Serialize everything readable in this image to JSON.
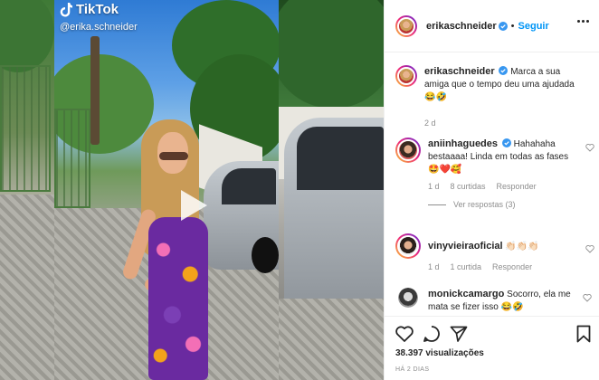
{
  "media": {
    "watermark_brand": "TikTok",
    "watermark_handle": "@erika.schneider"
  },
  "post": {
    "author": "erikaschneider",
    "follow_label": "Seguir",
    "dot": "•",
    "caption": "Marca a sua amiga que o tempo deu uma ajudada 😂🤣",
    "caption_continued": "😂🤣",
    "caption_time": "2 d"
  },
  "comments": [
    {
      "user": "aniinhaguedes",
      "text": "Hahahaha bestaaaa! Linda em todas as fases",
      "emojis": "🤩❤️🥰",
      "time": "1 d",
      "likes": "8 curtidas",
      "reply": "Responder",
      "view_replies": "Ver respostas (3)"
    },
    {
      "user": "vinyvieiraoficial",
      "text": "👏🏻👏🏻👏🏻",
      "time": "1 d",
      "likes": "1 curtida",
      "reply": "Responder"
    },
    {
      "user": "monickcamargo",
      "text": "Socorro, ela me mata se fizer isso 😂🤣"
    }
  ],
  "footer": {
    "views": "38.397 visualizações",
    "date": "HÁ 2 DIAS"
  },
  "colors": {
    "accent": "#0095f6",
    "verified": "#3897f0",
    "text": "#262626",
    "muted": "#8e8e8e"
  },
  "icons": [
    "tiktok-icon",
    "play-icon",
    "verified-icon",
    "more-icon",
    "heart-icon",
    "comment-icon",
    "share-icon",
    "bookmark-icon"
  ]
}
